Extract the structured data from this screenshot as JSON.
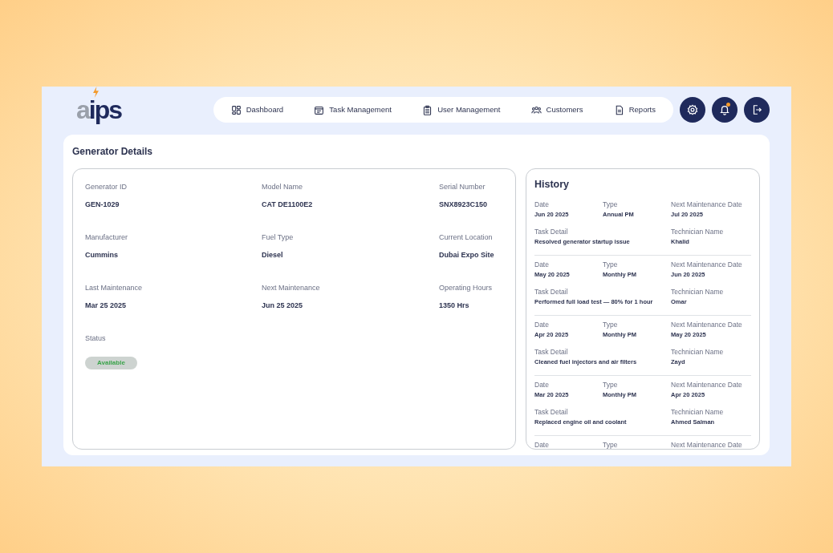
{
  "logo": {
    "text": "aips"
  },
  "nav": [
    {
      "label": "Dashboard",
      "selected": false
    },
    {
      "label": "Task Management",
      "selected": false
    },
    {
      "label": "User Management",
      "selected": false
    },
    {
      "label": "Customers",
      "selected": false
    },
    {
      "label": "Reports",
      "selected": false
    }
  ],
  "actions": {
    "notifications_unread": true
  },
  "page_title": "Generator Details",
  "details": [
    {
      "label": "Generator ID",
      "value": "GEN-1029"
    },
    {
      "label": "Model Name",
      "value": "CAT DE1100E2"
    },
    {
      "label": "Serial Number",
      "value": "SNX8923C150"
    },
    {
      "label": "Manufacturer",
      "value": "Cummins"
    },
    {
      "label": "Fuel Type",
      "value": "Diesel"
    },
    {
      "label": "Current Location",
      "value": "Dubai Expo Site"
    },
    {
      "label": "Last Maintenance",
      "value": "Mar 25 2025"
    },
    {
      "label": "Next Maintenance",
      "value": "Jun 25 2025"
    },
    {
      "label": "Operating Hours",
      "value": "1350 Hrs"
    }
  ],
  "status": {
    "label": "Status",
    "value": "Available"
  },
  "history": {
    "title": "History",
    "entries": [
      {
        "fields": [
          {
            "label": "Date",
            "value": "Jun 20 2025"
          },
          {
            "label": "Type",
            "value": "Annual PM"
          },
          {
            "label": "Next Maintenance Date",
            "value": "Jul 20 2025"
          },
          {
            "label": "Task Detail",
            "value": "Resolved generator startup issue"
          },
          {
            "label": "Technician Name",
            "value": "Khalid"
          }
        ]
      },
      {
        "fields": [
          {
            "label": "Date",
            "value": "May 20 2025"
          },
          {
            "label": "Type",
            "value": "Monthly PM"
          },
          {
            "label": "Next Maintenance Date",
            "value": "Jun 20 2025"
          },
          {
            "label": "Task Detail",
            "value": "Performed full load test — 80% for 1 hour"
          },
          {
            "label": "Technician Name",
            "value": "Omar"
          }
        ]
      },
      {
        "fields": [
          {
            "label": "Date",
            "value": "Apr 20 2025"
          },
          {
            "label": "Type",
            "value": "Monthly PM"
          },
          {
            "label": "Next Maintenance Date",
            "value": "May 20 2025"
          },
          {
            "label": "Task Detail",
            "value": "Cleaned fuel injectors and air filters"
          },
          {
            "label": "Technician Name",
            "value": "Zayd"
          }
        ]
      },
      {
        "fields": [
          {
            "label": "Date",
            "value": "Mar 20 2025"
          },
          {
            "label": "Type",
            "value": "Monthly PM"
          },
          {
            "label": "Next Maintenance Date",
            "value": "Apr 20 2025"
          },
          {
            "label": "Task Detail",
            "value": "Replaced engine oil and coolant"
          },
          {
            "label": "Technician Name",
            "value": "Ahmed Salman"
          }
        ]
      },
      {
        "fields": [
          {
            "label": "Date"
          },
          {
            "label": "Type"
          },
          {
            "label": "Next Maintenance Date"
          }
        ]
      }
    ]
  }
}
